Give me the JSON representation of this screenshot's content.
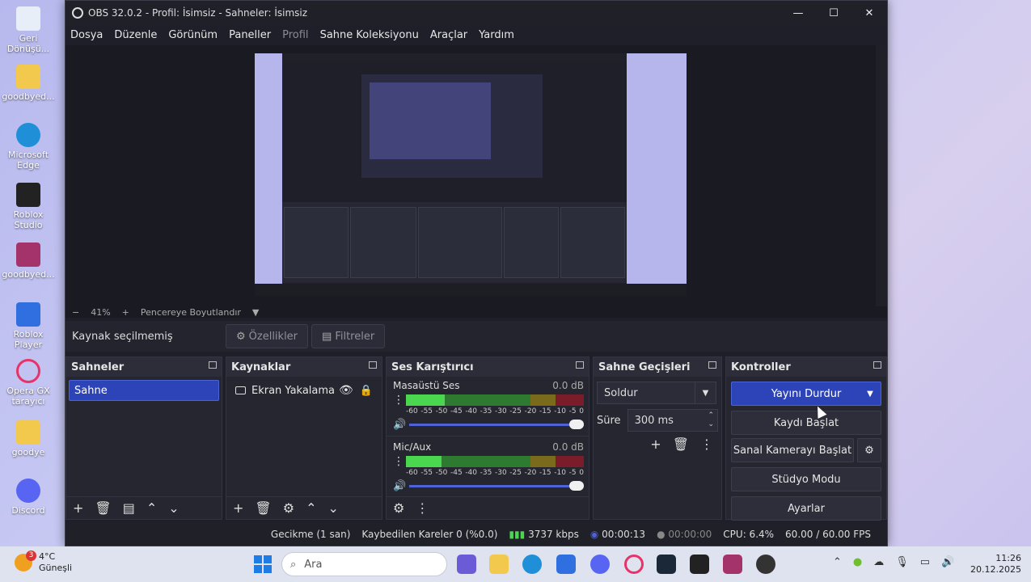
{
  "desktop": {
    "icons": [
      {
        "label": "Geri Dönüşü...",
        "icon": "recycle-bin-icon",
        "color": "#e8eef8"
      },
      {
        "label": "goodbyed...",
        "icon": "folder-icon",
        "color": "#f2c94c"
      },
      {
        "label": "Microsoft Edge",
        "icon": "edge-icon",
        "color": "#1f8fd8"
      },
      {
        "label": "Roblox Studio",
        "icon": "roblox-studio-icon",
        "color": "#222222"
      },
      {
        "label": "goodbyed...",
        "icon": "winrar-icon",
        "color": "#a5336b"
      },
      {
        "label": "Roblox Player",
        "icon": "roblox-player-icon",
        "color": "#2f6fe0"
      },
      {
        "label": "Opera GX tarayıcı",
        "icon": "opera-gx-icon",
        "color": "#e8326a"
      },
      {
        "label": "goodye",
        "icon": "folder-icon",
        "color": "#f2c94c"
      },
      {
        "label": "Discord",
        "icon": "discord-icon",
        "color": "#5865f2"
      }
    ]
  },
  "window": {
    "title": "OBS 32.0.2 - Profil: İsimsiz - Sahneler: İsimsiz",
    "min": "—",
    "max": "☐",
    "close": "✕"
  },
  "menu": {
    "items": [
      "Dosya",
      "Düzenle",
      "Görünüm",
      "Paneller",
      "Profil",
      "Sahne Koleksiyonu",
      "Araçlar",
      "Yardım"
    ]
  },
  "zoom": {
    "minus": "−",
    "level": "41%",
    "plus": "+",
    "fit": "Pencereye Boyutlandır",
    "menu_arrow": "▼"
  },
  "source_bar": {
    "status": "Kaynak seçilmemiş",
    "properties": "Özellikler",
    "filters": "Filtreler"
  },
  "scenes": {
    "title": "Sahneler",
    "items": [
      "Sahne"
    ]
  },
  "sources": {
    "title": "Kaynaklar",
    "items": [
      "Ekran Yakalama"
    ]
  },
  "mixer": {
    "title": "Ses Karıştırıcı",
    "channels": [
      {
        "name": "Masaüstü Ses",
        "db": "0.0 dB"
      },
      {
        "name": "Mic/Aux",
        "db": "0.0 dB"
      }
    ],
    "ticks": [
      "-60",
      "-55",
      "-50",
      "-45",
      "-40",
      "-35",
      "-30",
      "-25",
      "-20",
      "-15",
      "-10",
      "-5",
      "0"
    ]
  },
  "transitions": {
    "title": "Sahne Geçişleri",
    "selected": "Soldur",
    "duration_label": "Süre",
    "duration_value": "300 ms"
  },
  "controls": {
    "title": "Kontroller",
    "stop_stream": "Yayını Durdur",
    "start_record": "Kaydı Başlat",
    "virtual_cam": "Sanal Kamerayı Başlat",
    "studio_mode": "Stüdyo Modu",
    "settings": "Ayarlar"
  },
  "status": {
    "delay": "Gecikme (1 san)",
    "dropped": "Kaybedilen Kareler 0 (%0.0)",
    "bitrate": "3737 kbps",
    "stream_time": "00:00:13",
    "record_time": "00:00:00",
    "cpu": "CPU: 6.4%",
    "fps": "60.00 / 60.00 FPS"
  },
  "taskbar": {
    "weather_temp": "4°C",
    "weather_desc": "Güneşli",
    "weather_badge": "3",
    "search_placeholder": "Ara",
    "time": "11:26",
    "date": "20.12.2025"
  },
  "colors": {
    "accent": "#2d44b8",
    "meter_green": "#4bd64f",
    "meter_yellow": "#7a6a1c",
    "meter_red": "#7a1c2a"
  }
}
